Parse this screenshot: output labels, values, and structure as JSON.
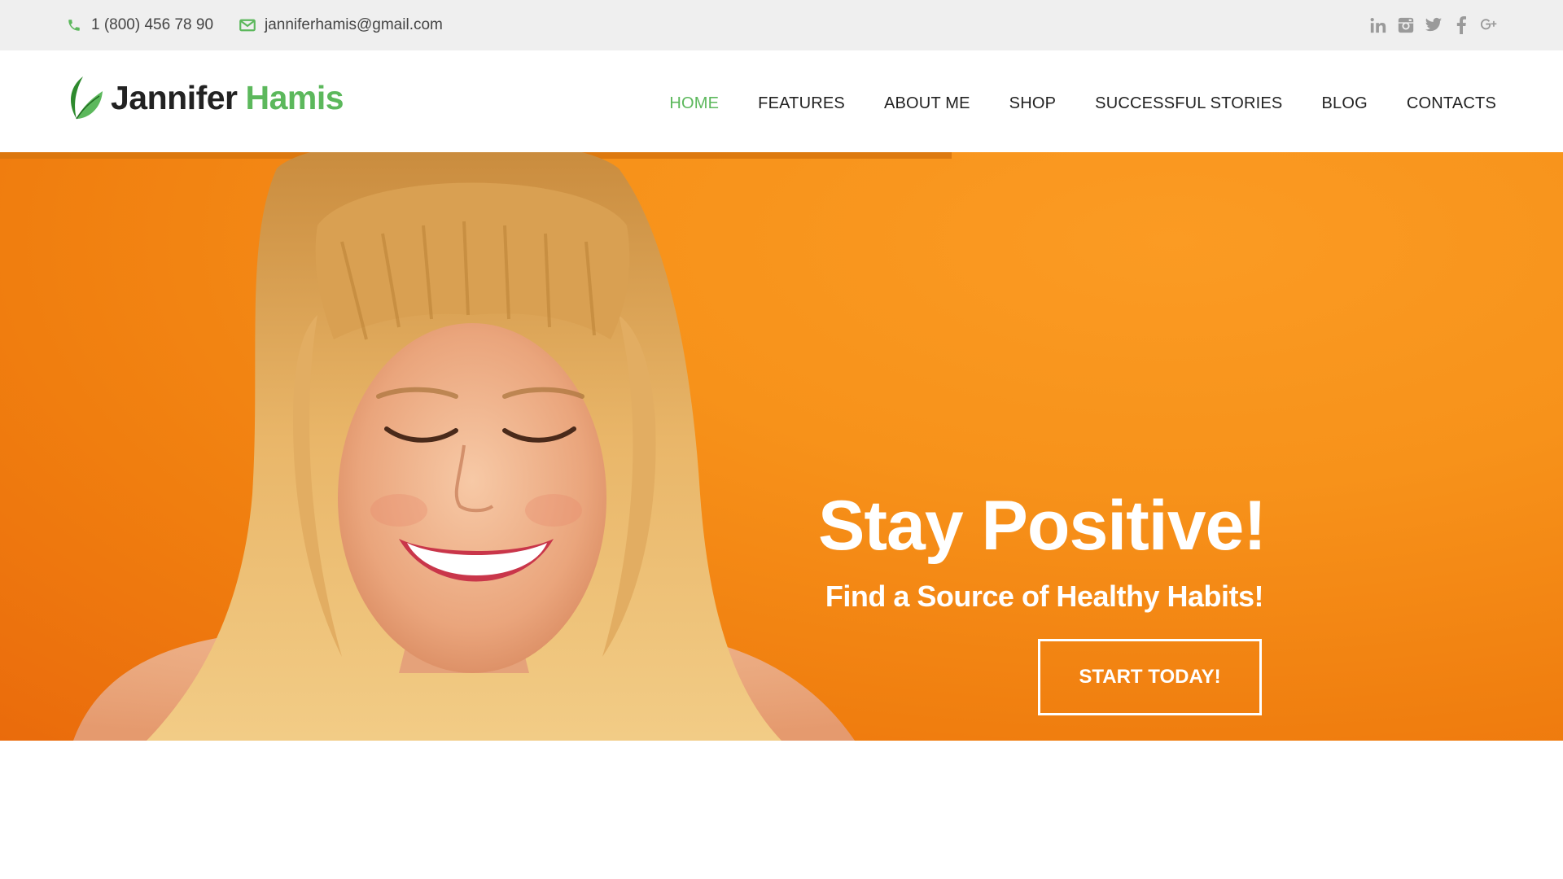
{
  "topbar": {
    "phone": "1 (800) 456 78 90",
    "email": "janniferhamis@gmail.com",
    "phone_icon": "phone-icon",
    "email_icon": "envelope-icon",
    "social": [
      "linkedin-icon",
      "instagram-icon",
      "twitter-icon",
      "facebook-icon",
      "google-plus-icon"
    ]
  },
  "header": {
    "logo_first": "Jannifer",
    "logo_last": "Hamis",
    "nav": [
      {
        "label": "HOME",
        "active": true
      },
      {
        "label": "FEATURES",
        "active": false
      },
      {
        "label": "ABOUT ME",
        "active": false
      },
      {
        "label": "SHOP",
        "active": false
      },
      {
        "label": "SUCCESSFUL STORIES",
        "active": false
      },
      {
        "label": "BLOG",
        "active": false
      },
      {
        "label": "CONTACTS",
        "active": false
      }
    ]
  },
  "hero": {
    "title": "Stay Positive!",
    "subtitle": "Find a Source of Healthy Habits!",
    "cta": "START TODAY!",
    "slides": 2,
    "active_slide": 2
  },
  "colors": {
    "accent": "#5cb85c",
    "hero_orange": "#f7921a",
    "topbar_bg": "#efefef",
    "text_dark": "#222222",
    "icon_gray": "#9a9a9a"
  }
}
